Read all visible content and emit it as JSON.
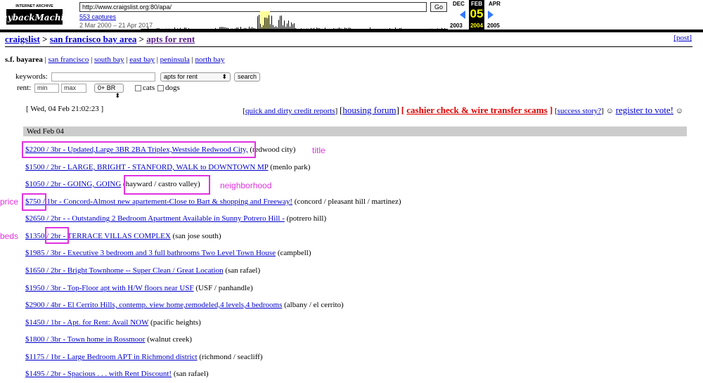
{
  "wayback": {
    "logo_top": "INTERNET ARCHIVE",
    "logo_main": "WaybackMachine",
    "url": "http://www.craigslist.org:80/apa/",
    "go_label": "Go",
    "captures": "553 captures",
    "date_range": "2 Mar 2000 – 21 Apr 2017",
    "prev_month": "DEC",
    "cur_month": "FEB",
    "next_month": "APR",
    "day": "05",
    "prev_year": "2003",
    "cur_year": "2004",
    "next_year": "2005"
  },
  "breadcrumb": {
    "site": "craigslist",
    "sep1": ">",
    "area": "san francisco bay area",
    "sep2": ">",
    "section": "apts for rent"
  },
  "post_link": "[post]",
  "areas": {
    "current": "s.f. bayarea",
    "links": [
      "san francisco",
      "south bay",
      "east bay",
      "peninsula",
      "north bay"
    ]
  },
  "search": {
    "keywords_label": "keywords:",
    "keywords_value": "",
    "category": "apts for rent",
    "search_button": "search",
    "rent_label": "rent:",
    "min_placeholder": "min",
    "max_placeholder": "max",
    "br_select": "0+ BR",
    "cats_label": "cats",
    "dogs_label": "dogs"
  },
  "date_stamp": "[ Wed, 04 Feb 21:02:23 ]",
  "promo": {
    "credit_reports": "quick and dirty credit reports",
    "housing_forum": "housing forum",
    "scam_warning": "cashier check & wire transfer scams",
    "success_story": "success story?",
    "register_vote": "register to vote!",
    "smile": "☺"
  },
  "day_header": "Wed Feb 04",
  "listings": [
    {
      "link": "$2200 / 3br - Updated,Large 3BR 2BA Triplex,Westside Redwood City,",
      "area": "(redwood city)"
    },
    {
      "link": "$1500 / 2br - LARGE, BRIGHT - STANFORD, WALK to DOWNTOWN MP",
      "area": "(menlo park)"
    },
    {
      "link": "$1050 / 2br - GOING, GOING",
      "area": "(hayward / castro valley)"
    },
    {
      "link": "$750 / 1br - Concord-Almost new apartement-Close to Bart & shopping and Freeway!",
      "area": "(concord / pleasant hill / martinez)"
    },
    {
      "link": "$2650 / 2br - - Outstanding 2 Bedroom Apartment Available in Sunny Potrero Hill -",
      "area": "(potrero hill)"
    },
    {
      "link": "$1350 / 2br - TERRACE VILLAS COMPLEX",
      "area": "(san jose south)"
    },
    {
      "link": "$1985 / 3br - Executive 3 bedroom and 3 full bathrooms Two Level Town House",
      "area": "(campbell)"
    },
    {
      "link": "$1650 / 2br - Bright Townhome -- Super Clean / Great Location",
      "area": "(san rafael)"
    },
    {
      "link": "$1950 / 3br - Top-Floor apt with H/W floors near USF",
      "area": "(USF / panhandle)"
    },
    {
      "link": "$2900 / 4br - El Cerrito Hills, contemp. view home,remodeled,4 levels,4 bedrooms",
      "area": "(albany / el cerrito)"
    },
    {
      "link": "$1450 / 1br - Apt. for Rent: Avail NOW",
      "area": "(pacific heights)"
    },
    {
      "link": "$1800 / 3br - Town home in Rossmoor",
      "area": "(walnut creek)"
    },
    {
      "link": "$1175 / 1br - Large Bedroom APT in Richmond district",
      "area": "(richmond / seacliff)"
    },
    {
      "link": "$1495 / 2br - Spacious . . . with Rent Discount!",
      "area": "(san rafael)"
    }
  ],
  "annotations": {
    "title": "title",
    "neighborhood": "neighborhood",
    "price": "price",
    "beds": "beds"
  },
  "colors": {
    "link": "#0000cc",
    "annotation": "#e033e0",
    "scam_red": "#dd0000",
    "day_bar": "#cccccc"
  }
}
